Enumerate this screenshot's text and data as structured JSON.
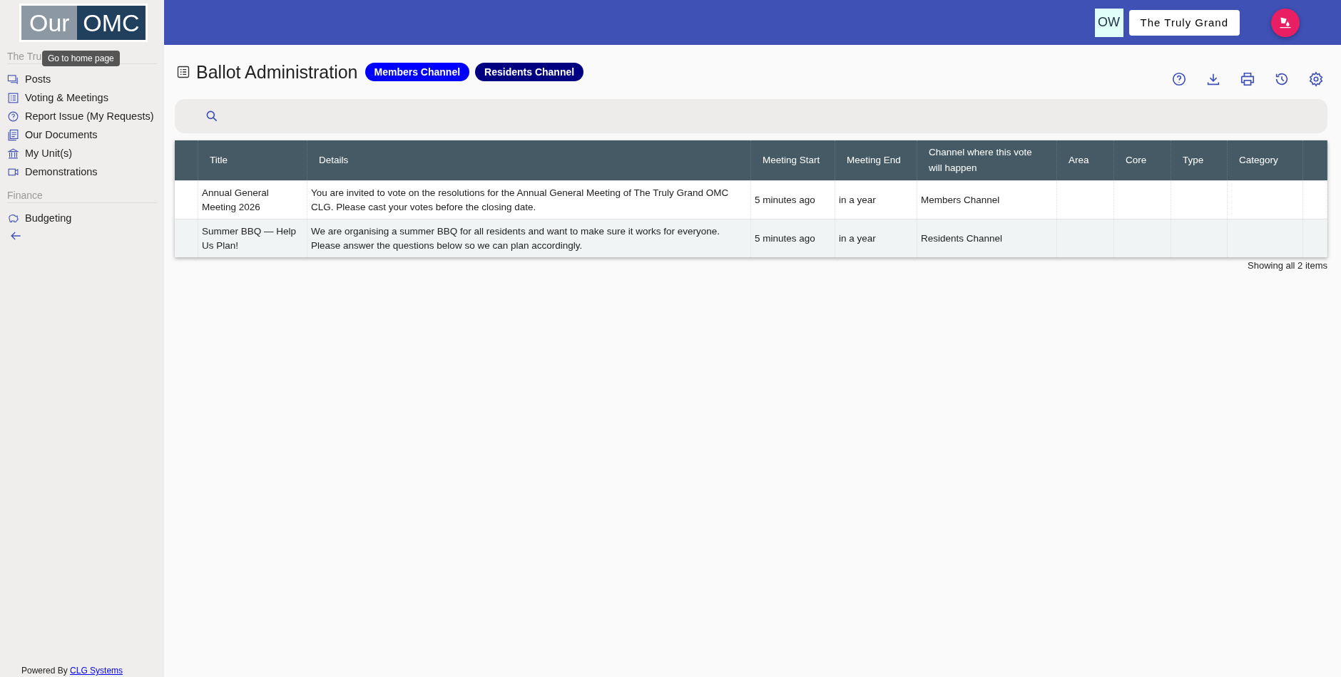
{
  "sidebar": {
    "logo": {
      "left": "Our",
      "right": "OMC"
    },
    "tooltip": "Go to home page",
    "groups": [
      {
        "label": "The Tru",
        "items": [
          {
            "label": "Posts",
            "kind": "posts"
          },
          {
            "label": "Voting & Meetings",
            "kind": "list"
          },
          {
            "label": "Report Issue (My Requests)",
            "kind": "help"
          },
          {
            "label": "Our Documents",
            "kind": "docs"
          },
          {
            "label": "My Unit(s)",
            "kind": "bank"
          },
          {
            "label": "Demonstrations",
            "kind": "video"
          }
        ]
      },
      {
        "label": "Finance",
        "items": [
          {
            "label": "Budgeting",
            "kind": "piggy"
          }
        ]
      }
    ],
    "footer": {
      "text": "Powered By",
      "link": "CLG Systems"
    }
  },
  "topbar": {
    "avatar": "OW",
    "org_button": "The Truly Grand"
  },
  "page": {
    "title": "Ballot Administration",
    "channels": [
      {
        "label": "Members Channel",
        "color": "#0000ff"
      },
      {
        "label": "Residents Channel",
        "color": "#000080"
      }
    ]
  },
  "table": {
    "columns": [
      "",
      "Title",
      "Details",
      "Meeting Start",
      "Meeting End",
      "Channel where this vote will happen",
      "Area",
      "Core",
      "Type",
      "Category",
      ""
    ],
    "rows": [
      [
        "",
        "Annual General Meeting 2026",
        "You are invited to vote on the resolutions for the Annual General Meeting of The Truly Grand OMC CLG. Please cast your votes before the closing date.",
        "5 minutes ago",
        "in a year",
        "Members Channel",
        "",
        "",
        "",
        "",
        ""
      ],
      [
        "",
        "Summer BBQ — Help Us Plan!",
        "We are organising a summer BBQ for all residents and want to make sure it works for everyone. Please answer the questions below so we can plan accordingly.",
        "5 minutes ago",
        "in a year",
        "Residents Channel",
        "",
        "",
        "",
        "",
        ""
      ]
    ],
    "footer": "Showing all 2 items"
  }
}
